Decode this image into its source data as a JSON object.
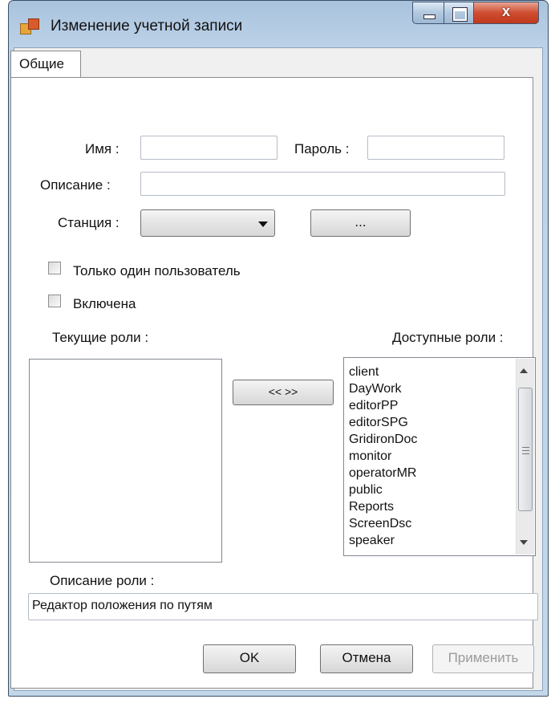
{
  "window": {
    "title": "Изменение учетной записи",
    "close_glyph": "x"
  },
  "tabs": [
    {
      "label": "Общие",
      "selected": true
    }
  ],
  "form": {
    "name_label": "Имя :",
    "name_value": "",
    "password_label": "Пароль :",
    "password_value": "",
    "description_label": "Описание :",
    "description_value": "",
    "station_label": "Станция :",
    "station_value": "",
    "browse_button": "...",
    "single_user_label": "Только один пользователь",
    "single_user_checked": false,
    "enabled_label": "Включена",
    "enabled_checked": false
  },
  "roles": {
    "current_label": "Текущие роли :",
    "current_items": [],
    "available_label": "Доступные роли :",
    "available_items": [
      "client",
      "DayWork",
      "editorPP",
      "editorSPG",
      "GridironDoc",
      "monitor",
      "operatorMR",
      "public",
      "Reports",
      "ScreenDsc",
      "speaker"
    ],
    "transfer_button": "<< >>",
    "role_description_label": "Описание роли :",
    "role_description_value": "Редактор положения по путям"
  },
  "buttons": {
    "ok": "OK",
    "cancel": "Отмена",
    "apply": "Применить",
    "apply_enabled": false
  },
  "colors": {
    "title_bar": "#bcd2e8",
    "close_button": "#cf4d30",
    "panel_background": "#ffffff",
    "dialog_background": "#f0f0f0"
  },
  "icons": [
    "app-icon",
    "minimize-icon",
    "maximize-icon",
    "close-icon",
    "dropdown-arrow-icon",
    "scroll-up-icon",
    "scroll-down-icon"
  ]
}
